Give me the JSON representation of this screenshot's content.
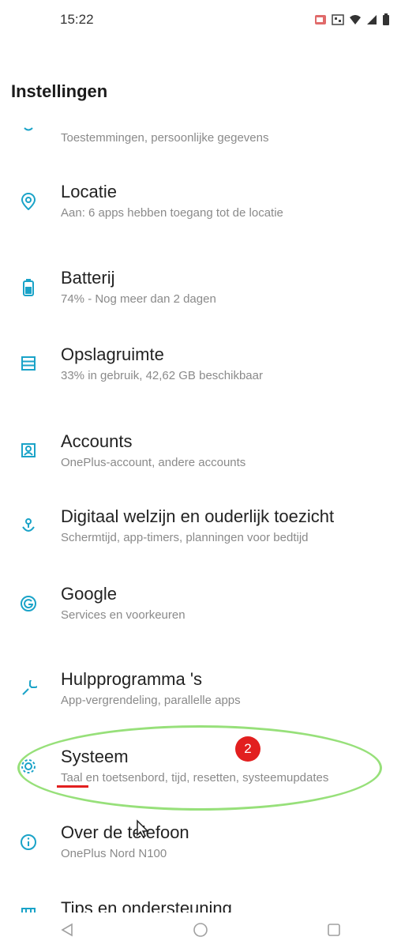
{
  "status_bar": {
    "time": "15:22",
    "icons": [
      "cast-icon",
      "nfc-icon",
      "wifi-icon",
      "signal-icon",
      "battery-icon"
    ]
  },
  "header": {
    "title": "Instellingen"
  },
  "items": [
    {
      "title": "",
      "subtitle": "Toestemmingen, persoonlijke gegevens",
      "icon": "privacy-icon"
    },
    {
      "title": "Locatie",
      "subtitle": "Aan: 6 apps hebben toegang tot de locatie",
      "icon": "location-icon"
    },
    {
      "title": "Batterij",
      "subtitle": "74% - Nog meer dan 2 dagen",
      "icon": "battery-icon"
    },
    {
      "title": "Opslagruimte",
      "subtitle": "33% in gebruik, 42,62 GB beschikbaar",
      "icon": "storage-icon"
    },
    {
      "title": "Accounts",
      "subtitle": "OnePlus-account, andere accounts",
      "icon": "accounts-icon"
    },
    {
      "title": "Digitaal welzijn en ouderlijk toezicht",
      "subtitle": "Schermtijd, app-timers, planningen voor bedtijd",
      "icon": "wellbeing-icon"
    },
    {
      "title": "Google",
      "subtitle": "Services en voorkeuren",
      "icon": "google-icon"
    },
    {
      "title": "Hulpprogramma 's",
      "subtitle": "App-vergrendeling, parallelle apps",
      "icon": "utilities-icon"
    },
    {
      "title": "Systeem",
      "subtitle": "Taal en toetsenbord, tijd, resetten, systeemupdates",
      "icon": "gear-icon"
    },
    {
      "title": "Over de telefoon",
      "subtitle": "OnePlus Nord N100",
      "icon": "info-icon"
    },
    {
      "title": "Tips en ondersteuning",
      "subtitle": "",
      "icon": "tips-icon"
    }
  ],
  "annotation": {
    "badge": "2",
    "color": "#e21f1f",
    "highlight_color": "#97e07a"
  },
  "accent_color": "#1aa3c8"
}
